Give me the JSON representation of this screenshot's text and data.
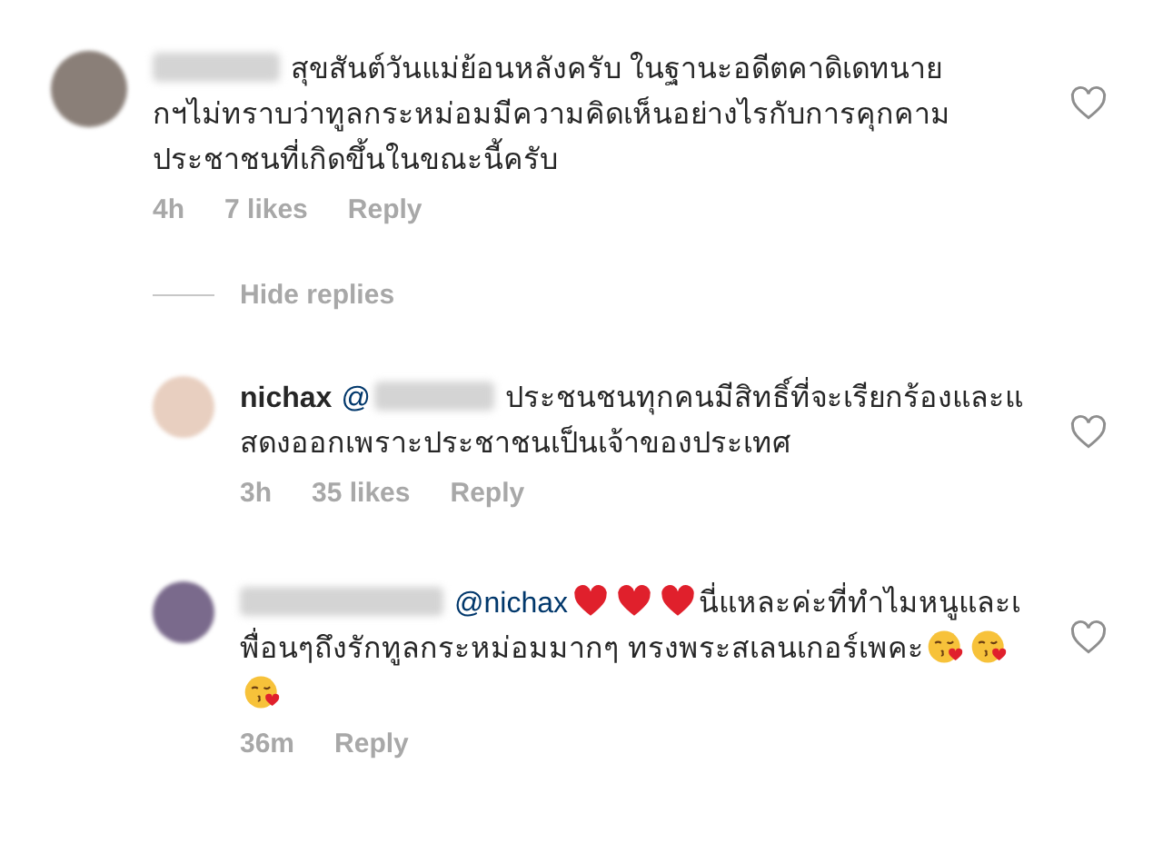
{
  "comments": [
    {
      "avatar": {
        "color": "#8a7f78"
      },
      "parts": [
        {
          "kind": "blurred"
        },
        {
          "kind": "text",
          "text": "สุขสันต์วันแม่ย้อนหลังครับ  ในฐานะอดีตคาดิเดทนายกฯไม่ทราบว่าทูลกระหม่อมมีความคิดเห็นอย่างไรกับการคุกคามประชาชนที่เกิดขึ้นในขณะนี้ครับ"
        }
      ],
      "time": "4h",
      "likes": "7 likes",
      "reply": "Reply",
      "liked": false,
      "hide_replies": "Hide replies",
      "replies": [
        {
          "avatar": {
            "color": "#e8cfc0"
          },
          "parts": [
            {
              "kind": "author",
              "text": "nichax"
            },
            {
              "kind": "mention_blurred",
              "text": "@"
            },
            {
              "kind": "text",
              "text": "ประชนชนทุกคนมีสิทธิ์ที่จะเรียกร้องและแสดงออกเพราะประชาชนเป็นเจ้าของประเทศ"
            }
          ],
          "time": "3h",
          "likes": "35 likes",
          "reply": "Reply",
          "liked": false
        },
        {
          "avatar": {
            "color": "#7a6a8c"
          },
          "parts": [
            {
              "kind": "blurred"
            },
            {
              "kind": "mention",
              "text": "@nichax"
            },
            {
              "kind": "heart-emoji"
            },
            {
              "kind": "heart-emoji"
            },
            {
              "kind": "heart-emoji"
            },
            {
              "kind": "text",
              "text": "นี่แหละค่ะที่ทำไมหนูและเพื่อนๆถึงรักทูลกระหม่อมมากๆ ทรงพระสเลนเกอร์เพคะ"
            },
            {
              "kind": "kiss-emoji"
            },
            {
              "kind": "kiss-emoji"
            },
            {
              "kind": "kiss-emoji"
            }
          ],
          "time": "36m",
          "reply": "Reply",
          "liked": false
        }
      ]
    }
  ]
}
